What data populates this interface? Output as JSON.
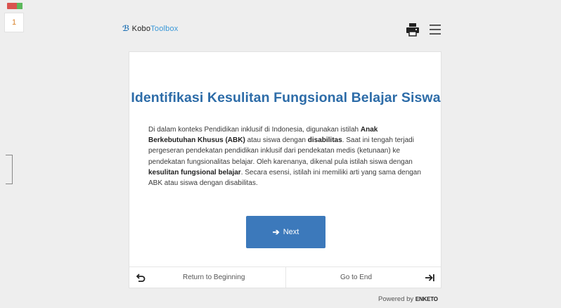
{
  "gutter": {
    "page_number": "1"
  },
  "header": {
    "logo_kobo": "Kobo",
    "logo_toolbox": "Toolbox",
    "print_icon": "printer-icon",
    "menu_icon": "hamburger-menu-icon"
  },
  "form": {
    "title": "Identifikasi Kesulitan Fungsional Belajar Siswa",
    "paragraph": [
      {
        "text": "Di dalam konteks Pendidikan inklusif di Indonesia, digunakan istilah ",
        "bold": false
      },
      {
        "text": "Anak Berkebutuhan Khusus (ABK)",
        "bold": true
      },
      {
        "text": " atau siswa dengan ",
        "bold": false
      },
      {
        "text": "disabilitas",
        "bold": true
      },
      {
        "text": ". Saat ini tengah terjadi pergeseran pendekatan pendidikan inklusif dari pendekatan medis (ketunaan) ke pendekatan fungsionalitas belajar. Oleh karenanya, dikenal pula istilah siswa dengan ",
        "bold": false
      },
      {
        "text": "kesulitan fungsional belajar",
        "bold": true
      },
      {
        "text": ". Secara esensi, istilah ini memiliki arti yang sama dengan ABK atau siswa dengan disabilitas.",
        "bold": false
      }
    ],
    "next_label": "Next",
    "next_icon": "arrow-right-icon"
  },
  "footer": {
    "return_label": "Return to Beginning",
    "return_icon": "return-arrow-icon",
    "goto_end_label": "Go to End",
    "goto_end_icon": "arrow-to-end-icon",
    "powered_by": "Powered by",
    "powered_brand": "ENKETO"
  },
  "colors": {
    "background": "#eeeeee",
    "title": "#2d6ca8",
    "button": "#3c79bb",
    "kobo_blue": "#1c6fb3"
  }
}
